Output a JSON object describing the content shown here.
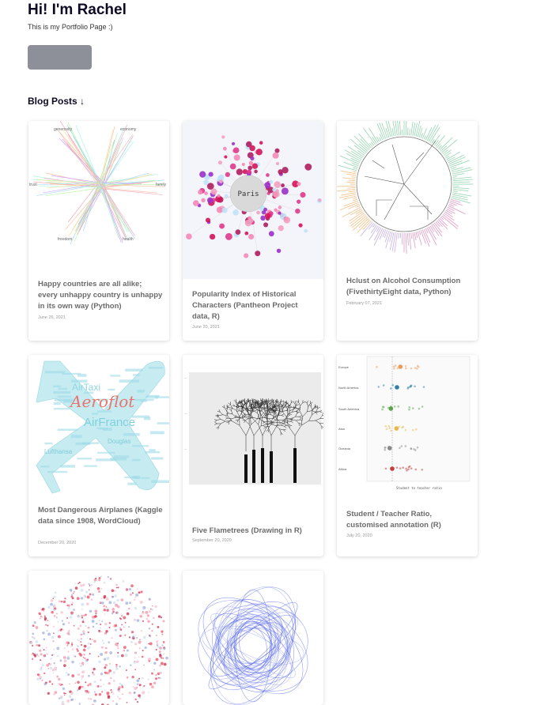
{
  "header": {
    "title": "Hi! I'm Rachel",
    "subtitle": "This is my Portfolio Page :)",
    "button_label": ""
  },
  "blog": {
    "heading": "Blog Posts ↓",
    "posts": [
      {
        "title": "Happy countries are all alike; every unhappy country is unhappy in its own way (Python)",
        "date": "June 26, 2021",
        "thumb_labels": [
          "generosity",
          "economy",
          "trust",
          "family",
          "freedom",
          "health"
        ]
      },
      {
        "title": "Popularity Index of Historical Characters (Pantheon Project data, R)",
        "date": "June 20, 2021",
        "thumb_labels": [
          "Paris"
        ]
      },
      {
        "title": "Hclust on Alcohol Consumption (FivethirtyEight data, Python)",
        "date": "February 07, 2021"
      },
      {
        "title": "Most Dangerous Airplanes (Kaggle data since 1908, WordCloud)",
        "date": "December 20, 2020",
        "thumb_labels": [
          "Aeroflot",
          "AirFrance",
          "AirTaxi",
          "Lufthansa",
          "Douglas"
        ]
      },
      {
        "title": "Five Flametrees (Drawing in R)",
        "date": "September 20, 2020"
      },
      {
        "title": "Student / Teacher Ratio, customised annotation (R)",
        "date": "July 20, 2020",
        "thumb_labels": [
          "Europe",
          "North America",
          "South America",
          "Asia",
          "Oceania",
          "Africa",
          "Student to teacher ratio"
        ]
      },
      {
        "title": "",
        "date": ""
      },
      {
        "title": "",
        "date": ""
      }
    ]
  },
  "colors": {
    "accent": "#0f0a24",
    "button": "#8e9099",
    "card_title": "#6b6b6b"
  }
}
